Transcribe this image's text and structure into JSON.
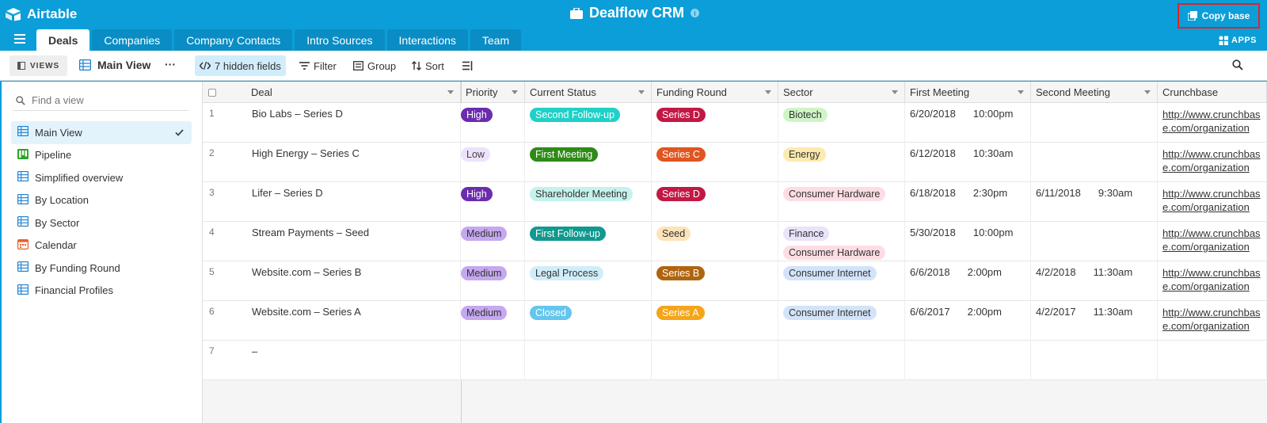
{
  "app": {
    "logo_text": "Airtable",
    "base_title": "Dealflow CRM",
    "copy_base_label": "Copy base",
    "apps_label": "APPS"
  },
  "tabs": [
    {
      "label": "Deals",
      "active": true
    },
    {
      "label": "Companies"
    },
    {
      "label": "Company Contacts"
    },
    {
      "label": "Intro Sources"
    },
    {
      "label": "Interactions"
    },
    {
      "label": "Team"
    }
  ],
  "toolbar": {
    "views_label": "VIEWS",
    "current_view": "Main View",
    "more_label": "···",
    "hidden_fields_label": "7 hidden fields",
    "filter_label": "Filter",
    "group_label": "Group",
    "sort_label": "Sort"
  },
  "sidebar": {
    "search_placeholder": "Find a view",
    "views": [
      {
        "label": "Main View",
        "icon": "grid-icon",
        "active": true
      },
      {
        "label": "Pipeline",
        "icon": "kanban-icon"
      },
      {
        "label": "Simplified overview",
        "icon": "grid-icon"
      },
      {
        "label": "By Location",
        "icon": "grid-icon"
      },
      {
        "label": "By Sector",
        "icon": "grid-icon"
      },
      {
        "label": "Calendar",
        "icon": "calendar-icon"
      },
      {
        "label": "By Funding Round",
        "icon": "grid-icon"
      },
      {
        "label": "Financial Profiles",
        "icon": "grid-icon"
      }
    ]
  },
  "grid": {
    "columns": [
      "Deal",
      "Priority",
      "Current Status",
      "Funding Round",
      "Sector",
      "First Meeting",
      "Second Meeting",
      "Crunchbase"
    ],
    "rows": [
      {
        "num": "1",
        "deal": "Bio Labs – Series D",
        "priority": "High",
        "status": "Second Follow-up",
        "round": "Series D",
        "sector": [
          "Biotech"
        ],
        "first_date": "6/20/2018",
        "first_time": "10:00pm",
        "second_date": "",
        "second_time": "",
        "crunchbase": "http://www.crunchbase.com/organization"
      },
      {
        "num": "2",
        "deal": "High Energy – Series C",
        "priority": "Low",
        "status": "First Meeting",
        "round": "Series C",
        "sector": [
          "Energy"
        ],
        "first_date": "6/12/2018",
        "first_time": "10:30am",
        "second_date": "",
        "second_time": "",
        "crunchbase": "http://www.crunchbase.com/organization"
      },
      {
        "num": "3",
        "deal": "Lifer – Series D",
        "priority": "High",
        "status": "Shareholder Meeting",
        "round": "Series D",
        "sector": [
          "Consumer Hardware"
        ],
        "first_date": "6/18/2018",
        "first_time": "2:30pm",
        "second_date": "6/11/2018",
        "second_time": "9:30am",
        "crunchbase": "http://www.crunchbase.com/organization"
      },
      {
        "num": "4",
        "deal": "Stream Payments – Seed",
        "priority": "Medium",
        "status": "First Follow-up",
        "round": "Seed",
        "sector": [
          "Finance",
          "Consumer Hardware"
        ],
        "first_date": "5/30/2018",
        "first_time": "10:00pm",
        "second_date": "",
        "second_time": "",
        "crunchbase": "http://www.crunchbase.com/organization"
      },
      {
        "num": "5",
        "deal": "Website.com – Series B",
        "priority": "Medium",
        "status": "Legal Process",
        "round": "Series B",
        "sector": [
          "Consumer Internet"
        ],
        "first_date": "6/6/2018",
        "first_time": "2:00pm",
        "second_date": "4/2/2018",
        "second_time": "11:30am",
        "crunchbase": "http://www.crunchbase.com/organization"
      },
      {
        "num": "6",
        "deal": "Website.com – Series A",
        "priority": "Medium",
        "status": "Closed",
        "round": "Series A",
        "sector": [
          "Consumer Internet"
        ],
        "first_date": "6/6/2017",
        "first_time": "2:00pm",
        "second_date": "4/2/2017",
        "second_time": "11:30am",
        "crunchbase": "http://www.crunchbase.com/organization"
      },
      {
        "num": "7",
        "deal": "–",
        "priority": "",
        "status": "",
        "round": "",
        "sector": [],
        "first_date": "",
        "first_time": "",
        "second_date": "",
        "second_time": "",
        "crunchbase": ""
      }
    ]
  },
  "colors": {
    "header_blue": "#0b9ed9",
    "priority": {
      "High": [
        "#6b2cae",
        "#fff"
      ],
      "Low": [
        "#ede2fb",
        "#444"
      ],
      "Medium": [
        "#c5a8f0",
        "#333"
      ]
    },
    "status": {
      "Second Follow-up": [
        "#1fd1c7",
        "#fff"
      ],
      "First Meeting": [
        "#2e8b17",
        "#fff"
      ],
      "Shareholder Meeting": [
        "#c4f2ec",
        "#333"
      ],
      "First Follow-up": [
        "#11998f",
        "#fff"
      ],
      "Legal Process": [
        "#d0eefa",
        "#333"
      ],
      "Closed": [
        "#63c6ee",
        "#fff"
      ]
    },
    "round": {
      "Series D": [
        "#c21845",
        "#fff"
      ],
      "Series C": [
        "#e05520",
        "#fff"
      ],
      "Seed": [
        "#fde3b8",
        "#333"
      ],
      "Series B": [
        "#b0640f",
        "#fff"
      ],
      "Series A": [
        "#f4a51b",
        "#fff"
      ]
    },
    "sector": {
      "Biotech": [
        "#cff5c6",
        "#333"
      ],
      "Energy": [
        "#fdeaae",
        "#333"
      ],
      "Consumer Hardware": [
        "#fddde3",
        "#333"
      ],
      "Finance": [
        "#ebe2fb",
        "#333"
      ],
      "Consumer Internet": [
        "#d3e3f9",
        "#333"
      ]
    }
  }
}
